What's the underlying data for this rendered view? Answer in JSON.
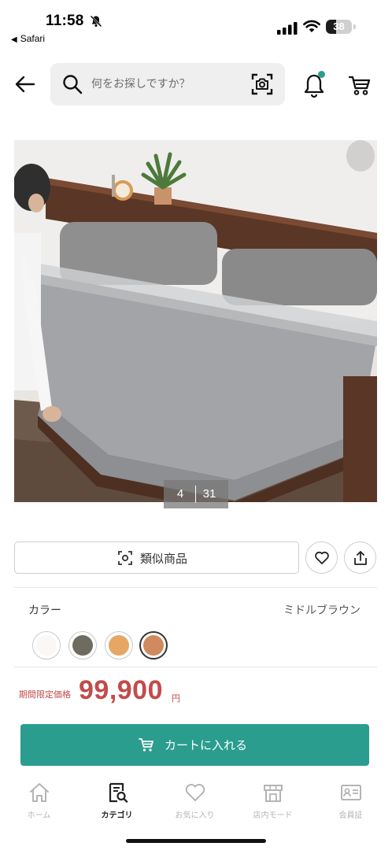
{
  "status_bar": {
    "time": "11:58",
    "back_app": "Safari",
    "battery_level": "38",
    "battery_fraction": 0.38
  },
  "header": {
    "search_placeholder": "何をお探しですか？",
    "notification_dot_color": "#2a9d8f"
  },
  "gallery": {
    "current": "4",
    "total": "31"
  },
  "actions": {
    "similar_label": "類似商品"
  },
  "color": {
    "label": "カラー",
    "selected_name": "ミドルブラウン",
    "swatches": [
      {
        "color": "#faf7f5",
        "selected": false
      },
      {
        "color": "#6e6c60",
        "selected": false
      },
      {
        "color": "#e6a765",
        "selected": false
      },
      {
        "color": "#cf8a5e",
        "selected": true
      }
    ]
  },
  "price": {
    "label": "期間限定価格",
    "value": "99,900",
    "unit": "円"
  },
  "cart_button": {
    "label": "カートに入れる"
  },
  "accent_color": "#2a9d8f",
  "price_color": "#c24b4b",
  "bottom_nav": [
    {
      "label": "ホーム",
      "icon": "home-icon",
      "active": false
    },
    {
      "label": "カテゴリ",
      "icon": "category-search-icon",
      "active": true
    },
    {
      "label": "お気に入り",
      "icon": "heart-icon",
      "active": false
    },
    {
      "label": "店内モード",
      "icon": "store-icon",
      "active": false
    },
    {
      "label": "会員証",
      "icon": "member-card-icon",
      "active": false
    }
  ]
}
